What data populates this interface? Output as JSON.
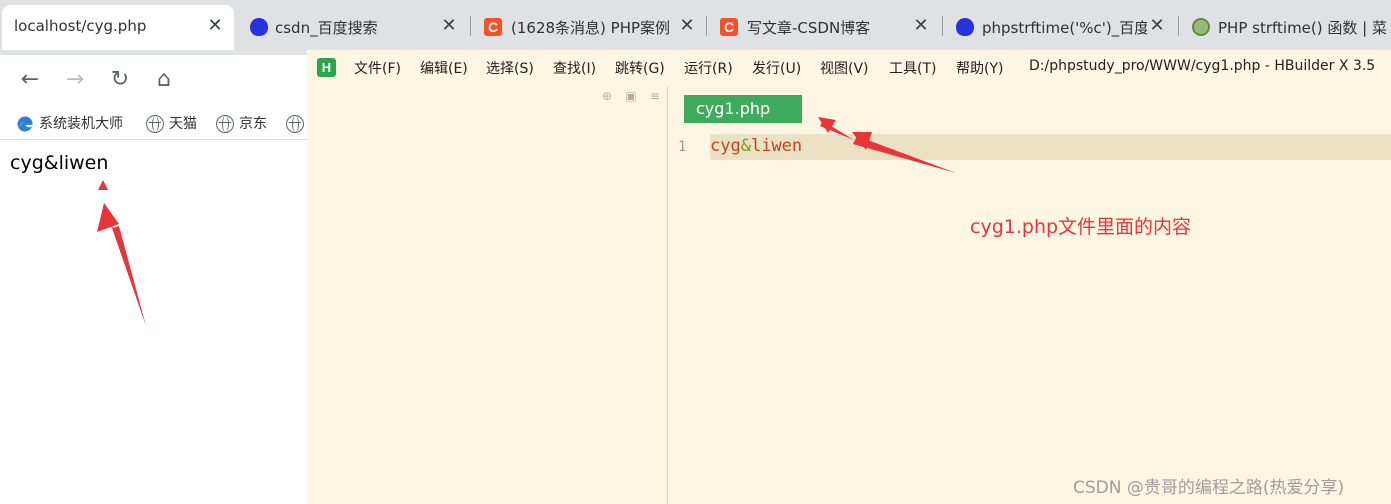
{
  "browser": {
    "tabs": [
      {
        "title": "localhost/cyg.php",
        "icon": "none",
        "active": true
      },
      {
        "title": "csdn_百度搜索",
        "icon": "baidu-icon",
        "active": false
      },
      {
        "title": "(1628条消息) PHP案例:",
        "icon": "csdn-icon",
        "active": false
      },
      {
        "title": "写文章-CSDN博客",
        "icon": "csdn-icon",
        "active": false
      },
      {
        "title": "phpstrftime('%c')_百度",
        "icon": "baidu-icon",
        "active": false
      },
      {
        "title": "PHP strftime() 函数 | 菜",
        "icon": "runoob-icon",
        "active": false
      }
    ],
    "close_glyph": "✕",
    "csdn_glyph": "C",
    "nav": {
      "back": "←",
      "forward": "→",
      "reload": "↻",
      "home": "⌂"
    },
    "bookmarks": [
      {
        "label": "系统装机大师",
        "icon": "edge-icon"
      },
      {
        "label": "天猫",
        "icon": "globe-icon"
      },
      {
        "label": "京东",
        "icon": "globe-icon"
      },
      {
        "label": "",
        "icon": "globe-icon"
      }
    ],
    "page_content": "cyg&liwen"
  },
  "editor": {
    "logo_glyph": "H",
    "menus": [
      "文件(F)",
      "编辑(E)",
      "选择(S)",
      "查找(I)",
      "跳转(G)",
      "运行(R)",
      "发行(U)",
      "视图(V)",
      "工具(T)",
      "帮助(Y)"
    ],
    "window_title": "D:/phpstudy_pro/WWW/cyg1.php - HBuilder X 3.5",
    "side_icons": {
      "locate": "⊕",
      "collapse": "▣",
      "menu": "≡"
    },
    "file_tab": "cyg1.php",
    "line_number": "1",
    "code": {
      "part1": "cyg",
      "part2": "&",
      "part3": "liwen"
    }
  },
  "annotation": {
    "note": "cyg1.php文件里面的内容",
    "color": "#e8343b"
  },
  "watermark": "CSDN @贵哥的编程之路(热爱分享)"
}
